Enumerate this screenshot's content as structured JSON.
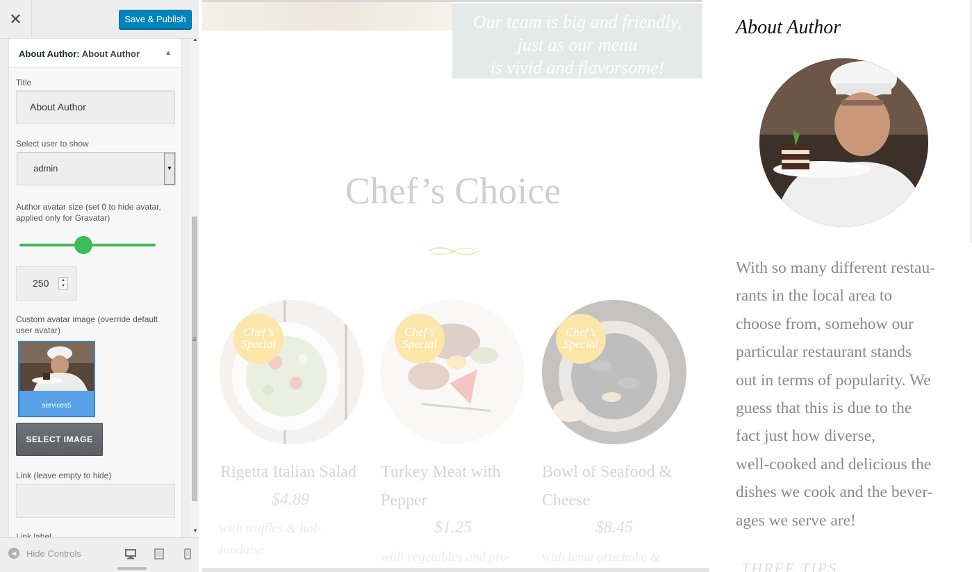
{
  "customizer": {
    "close_icon": "close-icon",
    "publish_label": "Save & Publish",
    "widget": {
      "title_prefix": "About Author:",
      "title_name": "About Author",
      "fields": {
        "title_label": "Title",
        "title_value": "About Author",
        "user_label": "Select user to show",
        "user_value": "admin",
        "avatar_size_label": "Author avatar size (set 0 to hide avatar, applied only for Gravatar)",
        "avatar_size_slider_fraction": 0.47,
        "avatar_size_value": "250",
        "custom_avatar_label": "Custom avatar image (override default user avatar)",
        "custom_avatar_caption": "services5",
        "select_image_label": "SELECT IMAGE",
        "link_label": "Link (leave empty to hide)",
        "link_value": "",
        "link_label2": "Link label"
      }
    },
    "footer": {
      "hide_controls_label": "Hide Controls",
      "devices": [
        "desktop-icon",
        "tablet-icon",
        "mobile-icon"
      ],
      "active_device": "desktop"
    }
  },
  "preview": {
    "banner_lines": [
      "Our team is big and friendly,",
      "just as our menu",
      "is vivid and flavorsome!"
    ],
    "section_title": "Chef’s Choice",
    "badge_text": [
      "Chef’s",
      "Special"
    ],
    "dishes": [
      {
        "name": "Rigetta Italian Salad",
        "price": "$4.89",
        "desc": "with truffles & hol-landaise"
      },
      {
        "name": "Turkey Meat with Pepper",
        "price": "$1.25",
        "desc": "with vegetables and pro-"
      },
      {
        "name": "Bowl of Seafood & Cheese",
        "price": "$8.45",
        "desc": "with tema artichoke &"
      }
    ],
    "about": {
      "title": "About Author",
      "text": "With so many different restaurants in the local area to choose from, somehow our particular restaurant stands out in terms of popularity. We guess that this is due to the fact just how diverse, well-cooked and delicious the dishes we cook and the beverages we serve are!",
      "text_lines": [
        "With so many different restau-",
        "rants in the local area to",
        "choose from, somehow our",
        "particular restaurant stands",
        "out in terms of popularity. We",
        "guess that this is due to the",
        "fact just how diverse,",
        "well-cooked and delicious the",
        "dishes we cook and the bever-",
        "ages we serve are!"
      ],
      "next_heading_partial": "THREE TIPS"
    },
    "colors": {
      "accent_blue": "#0085ba",
      "slider_green": "#3cbc5a",
      "badge_yellow": "#fce6a9"
    }
  }
}
